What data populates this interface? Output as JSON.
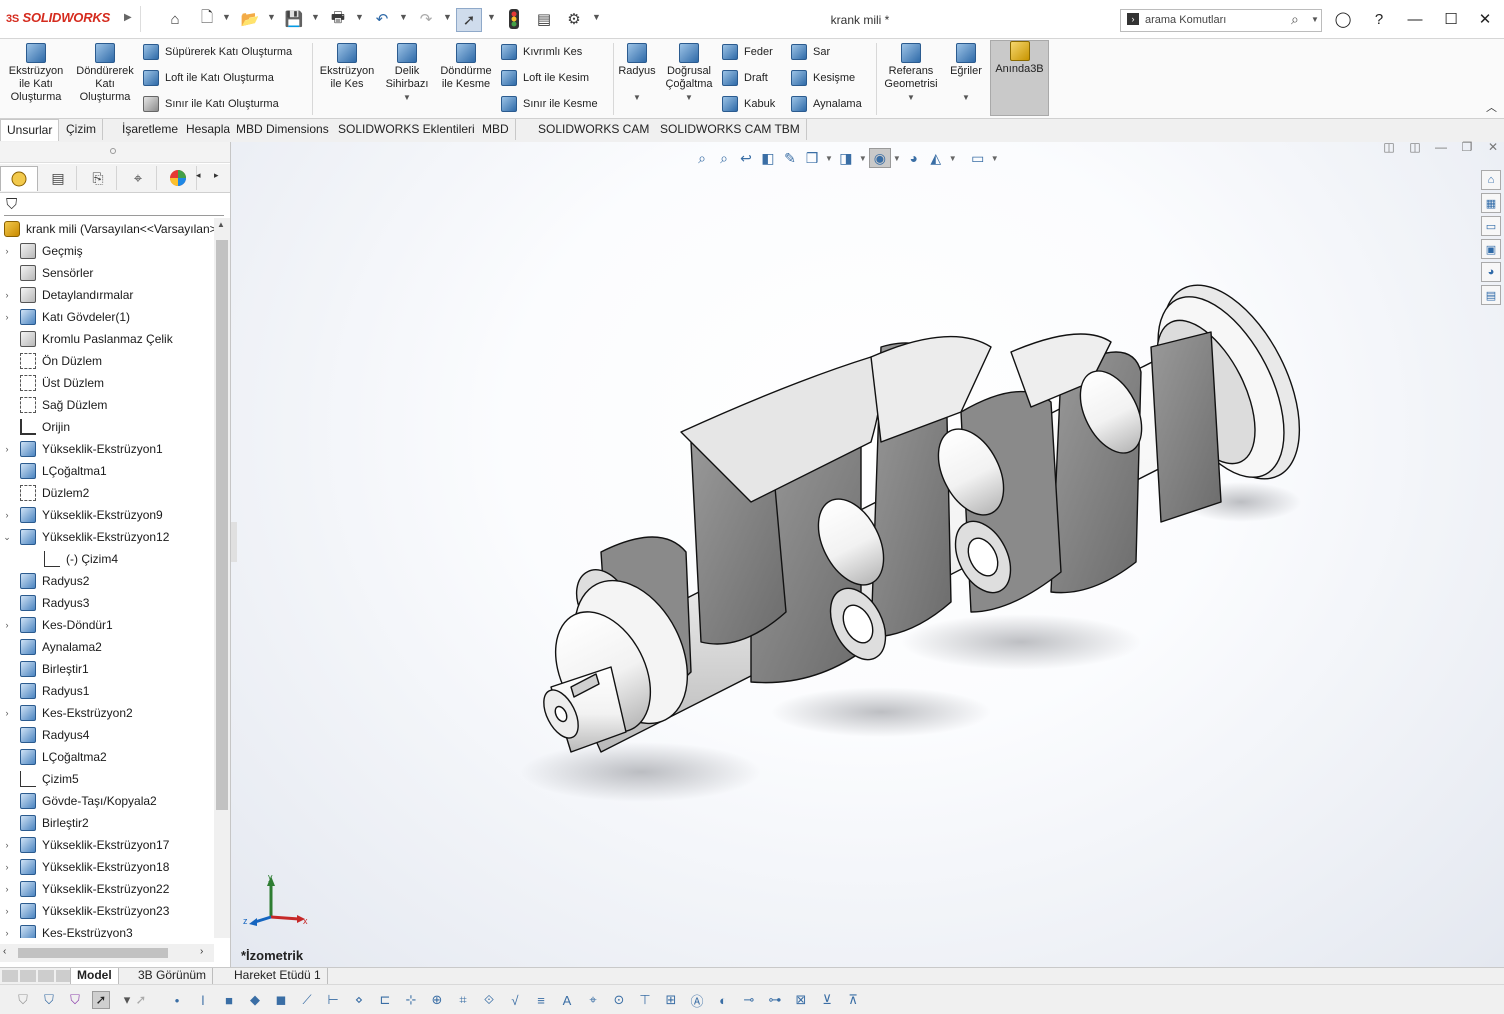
{
  "app": {
    "logo_prefix": "3S",
    "logo_text": "SOLIDWORKS",
    "document_title": "krank mili *"
  },
  "search": {
    "placeholder": "arama Komutları",
    "value": "arama Komutları"
  },
  "quick_access": {
    "icons": [
      "home-icon",
      "new-document-icon",
      "open-icon",
      "save-icon",
      "print-icon",
      "undo-icon",
      "redo-icon",
      "select-icon",
      "rebuild-icon",
      "file-properties-icon",
      "options-icon"
    ]
  },
  "ribbon": {
    "group1": [
      {
        "label1": "Ekstrüzyon",
        "label2": "ile Katı",
        "label3": "Oluşturma"
      },
      {
        "label1": "Döndürerek",
        "label2": "Katı",
        "label3": "Oluşturma"
      }
    ],
    "group1_small": [
      "Süpürerek Katı Oluşturma",
      "Loft ile Katı Oluşturma",
      "Sınır ile Katı Oluşturma"
    ],
    "group2": [
      {
        "label1": "Ekstrüzyon",
        "label2": "ile Kes",
        "label3": ""
      },
      {
        "label1": "Delik",
        "label2": "Sihirbazı",
        "label3": ""
      },
      {
        "label1": "Döndürme",
        "label2": "ile Kesme",
        "label3": ""
      }
    ],
    "group2_small": [
      "Kıvrımlı Kes",
      "Loft ile Kesim",
      "Sınır ile Kesme"
    ],
    "group3": [
      {
        "label1": "Radyus",
        "label2": "",
        "label3": ""
      },
      {
        "label1": "Doğrusal",
        "label2": "Çoğaltma",
        "label3": ""
      }
    ],
    "group3_small_a": [
      "Feder",
      "Draft",
      "Kabuk"
    ],
    "group3_small_b": [
      "Sar",
      "Kesişme",
      "Aynalama"
    ],
    "group4": [
      {
        "label1": "Referans",
        "label2": "Geometrisi",
        "label3": ""
      },
      {
        "label1": "Eğriler",
        "label2": "",
        "label3": ""
      },
      {
        "label1": "Anında3B",
        "label2": "",
        "label3": ""
      }
    ]
  },
  "tabs": [
    "Unsurlar",
    "Çizim",
    "İşaretleme",
    "Hesapla",
    "MBD Dimensions",
    "SOLIDWORKS Eklentileri",
    "MBD",
    "SOLIDWORKS CAM",
    "SOLIDWORKS CAM TBM"
  ],
  "tree": {
    "root": "krank mili  (Varsayılan<<Varsayılan>",
    "items": [
      {
        "label": "Geçmiş",
        "expand": "›",
        "icon": "history-icon"
      },
      {
        "label": "Sensörler",
        "expand": "",
        "icon": "sensor-icon"
      },
      {
        "label": "Detaylandırmalar",
        "expand": "›",
        "icon": "annotations-icon"
      },
      {
        "label": "Katı Gövdeler(1)",
        "expand": "›",
        "icon": "solid-bodies-icon"
      },
      {
        "label": "Kromlu Paslanmaz Çelik",
        "expand": "",
        "icon": "material-icon"
      },
      {
        "label": "Ön Düzlem",
        "expand": "",
        "icon": "plane-icon"
      },
      {
        "label": "Üst Düzlem",
        "expand": "",
        "icon": "plane-icon"
      },
      {
        "label": "Sağ Düzlem",
        "expand": "",
        "icon": "plane-icon"
      },
      {
        "label": "Orijin",
        "expand": "",
        "icon": "origin-icon"
      },
      {
        "label": "Yükseklik-Ekstrüzyon1",
        "expand": "›",
        "icon": "extrude-icon"
      },
      {
        "label": "LÇoğaltma1",
        "expand": "",
        "icon": "linear-pattern-icon"
      },
      {
        "label": "Düzlem2",
        "expand": "",
        "icon": "plane-icon"
      },
      {
        "label": "Yükseklik-Ekstrüzyon9",
        "expand": "›",
        "icon": "extrude-icon"
      },
      {
        "label": "Yükseklik-Ekstrüzyon12",
        "expand": "⌄",
        "icon": "extrude-icon"
      },
      {
        "label": "(-) Çizim4",
        "expand": "",
        "icon": "sketch-icon",
        "indent": true
      },
      {
        "label": "Radyus2",
        "expand": "",
        "icon": "fillet-icon"
      },
      {
        "label": "Radyus3",
        "expand": "",
        "icon": "fillet-icon"
      },
      {
        "label": "Kes-Döndür1",
        "expand": "›",
        "icon": "revolve-cut-icon"
      },
      {
        "label": "Aynalama2",
        "expand": "",
        "icon": "mirror-icon"
      },
      {
        "label": "Birleştir1",
        "expand": "",
        "icon": "combine-icon"
      },
      {
        "label": "Radyus1",
        "expand": "",
        "icon": "fillet-icon"
      },
      {
        "label": "Kes-Ekstrüzyon2",
        "expand": "›",
        "icon": "extrude-cut-icon"
      },
      {
        "label": "Radyus4",
        "expand": "",
        "icon": "fillet-icon"
      },
      {
        "label": "LÇoğaltma2",
        "expand": "",
        "icon": "linear-pattern-icon"
      },
      {
        "label": "Çizim5",
        "expand": "",
        "icon": "sketch-icon"
      },
      {
        "label": "Gövde-Taşı/Kopyala2",
        "expand": "",
        "icon": "move-copy-icon"
      },
      {
        "label": "Birleştir2",
        "expand": "",
        "icon": "combine-icon"
      },
      {
        "label": "Yükseklik-Ekstrüzyon17",
        "expand": "›",
        "icon": "extrude-icon"
      },
      {
        "label": "Yükseklik-Ekstrüzyon18",
        "expand": "›",
        "icon": "extrude-icon"
      },
      {
        "label": "Yükseklik-Ekstrüzyon22",
        "expand": "›",
        "icon": "extrude-icon"
      },
      {
        "label": "Yükseklik-Ekstrüzyon23",
        "expand": "›",
        "icon": "extrude-icon"
      },
      {
        "label": "Kes-Ekstrüzyon3",
        "expand": "›",
        "icon": "extrude-cut-icon"
      }
    ]
  },
  "viewport": {
    "view_name": "*İzometrik",
    "triad": {
      "x": "x",
      "y": "y",
      "z": "z"
    }
  },
  "bottom_tabs": [
    "Model",
    "3B Görünüm",
    "Hareket Etüdü 1"
  ],
  "colors": {
    "accent": "#2f6aa8",
    "logo_red": "#d52b1e",
    "tab_active": "#ffffff"
  }
}
